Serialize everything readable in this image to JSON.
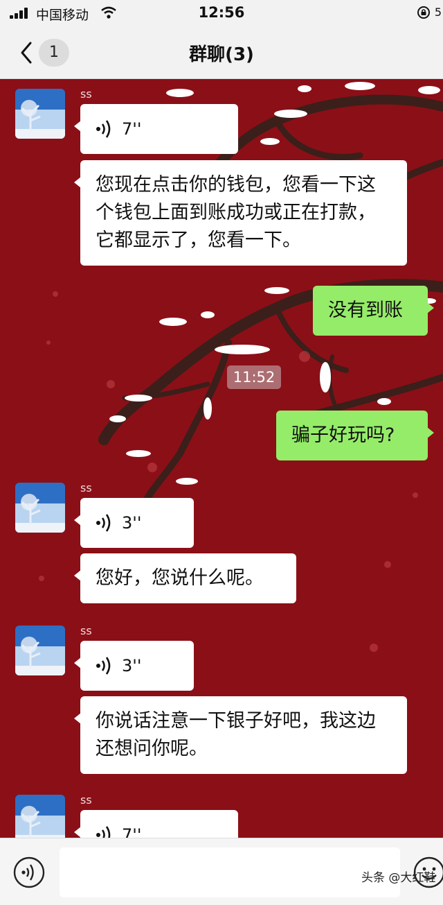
{
  "status_bar": {
    "carrier": "中国移动",
    "time": "12:56",
    "battery_text": "5"
  },
  "nav": {
    "unread_count": "1",
    "title": "群聊(3)"
  },
  "messages": [
    {
      "type": "voice",
      "sender": "ss",
      "duration": "7''"
    },
    {
      "type": "text",
      "sender": "ss",
      "text": "您现在点击你的钱包，您看一下这个钱包上面到账成功或正在打款，它都显示了，您看一下。"
    },
    {
      "type": "text",
      "sender": "me",
      "text": "没有到账"
    },
    {
      "type": "timestamp",
      "text": "11:52"
    },
    {
      "type": "text",
      "sender": "me",
      "text": "骗子好玩吗?"
    },
    {
      "type": "voice",
      "sender": "ss",
      "duration": "3''"
    },
    {
      "type": "text",
      "sender": "ss",
      "text": "您好，您说什么呢。"
    },
    {
      "type": "voice",
      "sender": "ss",
      "duration": "3''"
    },
    {
      "type": "text",
      "sender": "ss",
      "text": "你说话注意一下银子好吧，我这边还想问你呢。"
    },
    {
      "type": "voice",
      "sender": "ss",
      "duration": "7''"
    }
  ],
  "watermark": "头条 @大红鞋",
  "colors": {
    "chat_background": "#8b0f17",
    "outgoing_bubble": "#95ec69",
    "incoming_bubble": "#ffffff",
    "bar_background": "#f2f2f2"
  },
  "icons": [
    "signal-icon",
    "wifi-icon",
    "lock-rotation-icon",
    "back-chevron-icon",
    "voice-wave-icon",
    "voice-input-icon",
    "emoji-icon"
  ]
}
